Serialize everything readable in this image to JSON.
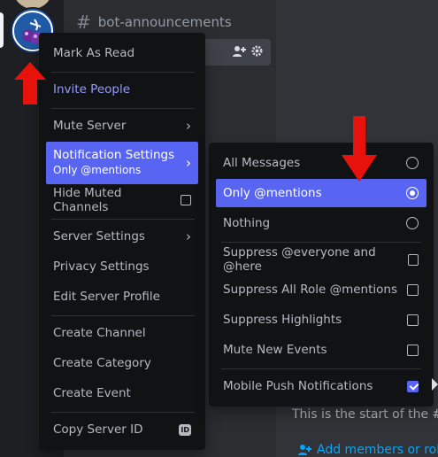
{
  "header": {
    "channel_name": "bot-announcements"
  },
  "context_menu": {
    "mark_as_read": "Mark As Read",
    "invite_people": "Invite People",
    "mute_server": "Mute Server",
    "notification_settings": "Notification Settings",
    "notification_settings_value": "Only @mentions",
    "hide_muted_channels": "Hide Muted Channels",
    "server_settings": "Server Settings",
    "privacy_settings": "Privacy Settings",
    "edit_server_profile": "Edit Server Profile",
    "create_channel": "Create Channel",
    "create_category": "Create Category",
    "create_event": "Create Event",
    "copy_server_id": "Copy Server ID",
    "id_badge": "ID"
  },
  "notification_submenu": {
    "all_messages": "All Messages",
    "only_mentions": "Only @mentions",
    "nothing": "Nothing",
    "suppress_everyone": "Suppress @everyone and @here",
    "suppress_role_mentions": "Suppress All Role @mentions",
    "suppress_highlights": "Suppress Highlights",
    "mute_new_events": "Mute New Events",
    "mobile_push": "Mobile Push Notifications",
    "selected": "Only @mentions"
  },
  "chat": {
    "welcome_text": "This is the start of the #",
    "add_members": "Add members or rol"
  },
  "colors": {
    "accent": "#5865f2",
    "arrow": "#e8120c",
    "menu_bg": "#111214"
  },
  "icons": [
    "hashtag-icon",
    "add-member-icon",
    "gear-icon",
    "chevron-right-icon",
    "checkbox-icon",
    "radio-icon",
    "id-badge-icon",
    "user-plus-icon",
    "red-arrow-icon"
  ]
}
